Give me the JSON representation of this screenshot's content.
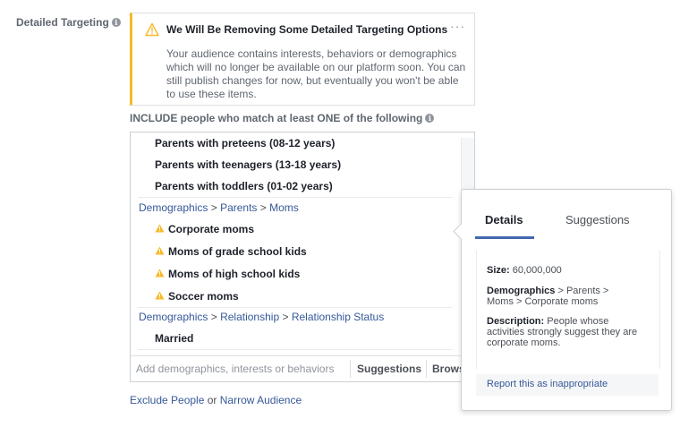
{
  "field": {
    "label": "Detailed Targeting",
    "info_icon": "info-icon"
  },
  "notice": {
    "title": "We Will Be Removing Some Detailed Targeting Options",
    "body": "Your audience contains interests, behaviors or demographics which will no longer be available on our platform soon. You can still publish changes for now, but eventually you won't be able to use these items.",
    "icon": "warning-icon",
    "more": "···",
    "accent_color": "#f7b928"
  },
  "include": {
    "label": "INCLUDE people who match at least ONE of the following"
  },
  "targeting": {
    "top_items": [
      "Parents with preteens (08-12 years)",
      "Parents with teenagers (13-18 years)",
      "Parents with toddlers (01-02 years)"
    ],
    "group1": {
      "crumb": [
        "Demographics",
        "Parents",
        "Moms"
      ],
      "items": [
        "Corporate moms",
        "Moms of grade school kids",
        "Moms of high school kids",
        "Soccer moms"
      ]
    },
    "group2": {
      "crumb": [
        "Demographics",
        "Relationship",
        "Relationship Status"
      ],
      "items": [
        "Married"
      ]
    },
    "crumb_separator": ">",
    "search_placeholder": "Add demographics, interests or behaviors",
    "suggestions_label": "Suggestions",
    "browse_label": "Browse"
  },
  "links": {
    "exclude": "Exclude People",
    "or": "or",
    "narrow": "Narrow Audience"
  },
  "popover": {
    "tabs": [
      "Details",
      "Suggestions"
    ],
    "size_label": "Size:",
    "size_value": "60,000,000",
    "category_label": "Demographics",
    "category_path": "> Parents > Moms > Corporate moms",
    "description_label": "Description:",
    "description_value": "People whose activities strongly suggest they are corporate moms.",
    "report": "Report this as inappropriate"
  },
  "colors": {
    "link": "#365899",
    "tab_active": "#4267b2",
    "warning": "#f7b928"
  }
}
